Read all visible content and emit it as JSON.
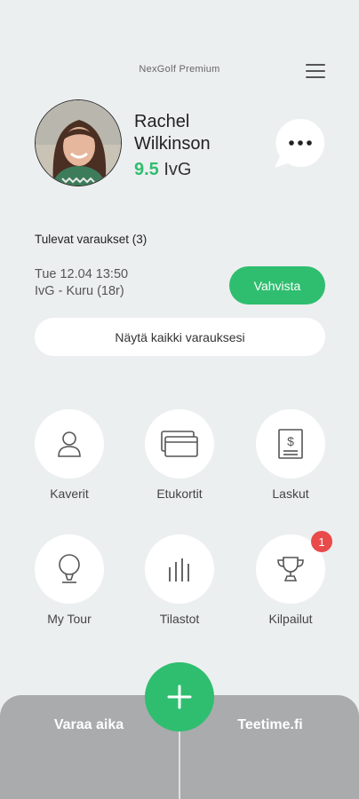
{
  "header": {
    "title": "NexGolf Premium"
  },
  "profile": {
    "first_name": "Rachel",
    "last_name": "Wilkinson",
    "handicap_value": "9.5",
    "handicap_unit": "IvG"
  },
  "bookings": {
    "title": "Tulevat varaukset (3)",
    "next_date": "Tue 12.04 13:50",
    "next_course": "IvG - Kuru (18r)",
    "confirm_label": "Vahvista",
    "show_all_label": "Näytä kaikki varauksesi"
  },
  "tiles": [
    {
      "label": "Kaverit",
      "icon": "person-icon"
    },
    {
      "label": "Etukortit",
      "icon": "cards-icon"
    },
    {
      "label": "Laskut",
      "icon": "invoice-icon"
    },
    {
      "label": "My Tour",
      "icon": "golf-ball-icon"
    },
    {
      "label": "Tilastot",
      "icon": "stats-bars-icon"
    },
    {
      "label": "Kilpailut",
      "icon": "trophy-icon",
      "badge": "1"
    }
  ],
  "bottom": {
    "left_label": "Varaa aika",
    "right_label": "Teetime.fi"
  },
  "colors": {
    "accent": "#2fbe6f",
    "badge": "#e94a4a",
    "background": "#eceff0",
    "bottom_bar": "#a9abad"
  }
}
